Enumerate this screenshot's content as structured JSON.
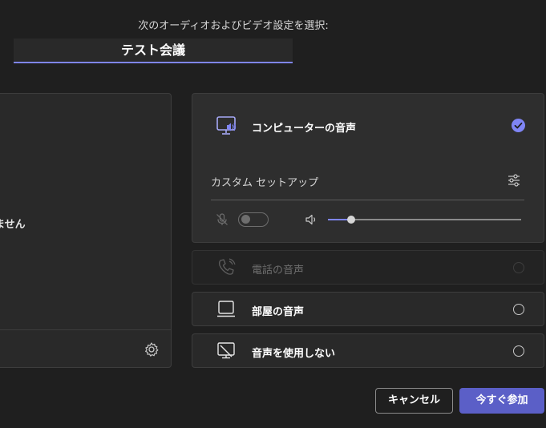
{
  "header": {
    "prompt": "次のオーディオおよびビデオ設定を選択:",
    "meeting_title": "テスト会議"
  },
  "video": {
    "status_text": "ません",
    "settings_icon": "gear-icon"
  },
  "audio_options": {
    "computer": {
      "label": "コンピューターの音声",
      "selected": true,
      "icon": "computer-audio-icon",
      "custom_setup_label": "カスタム セットアップ",
      "mic_enabled": false,
      "speaker_volume_fraction": 0.12
    },
    "phone": {
      "label": "電話の音声",
      "selected": false,
      "disabled": true,
      "icon": "phone-icon"
    },
    "room": {
      "label": "部屋の音声",
      "selected": false,
      "icon": "room-audio-icon"
    },
    "none": {
      "label": "音声を使用しない",
      "selected": false,
      "icon": "no-audio-icon"
    }
  },
  "buttons": {
    "cancel": "キャンセル",
    "join": "今すぐ参加"
  },
  "colors": {
    "background": "#1f1f1f",
    "panel": "#292929",
    "accent": "#7f85f5",
    "primary_button": "#5b5fc7"
  }
}
